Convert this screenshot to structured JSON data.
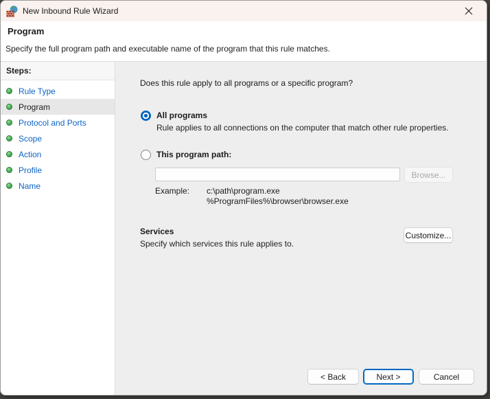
{
  "window": {
    "title": "New Inbound Rule Wizard"
  },
  "icons": {
    "titlebar": "firewall-icon",
    "close": "close-icon",
    "step_bullet": "green-dot-icon"
  },
  "header": {
    "title": "Program",
    "subtitle": "Specify the full program path and executable name of the program that this rule matches."
  },
  "sidebar": {
    "heading": "Steps:",
    "items": [
      {
        "label": "Rule Type",
        "active": false
      },
      {
        "label": "Program",
        "active": true
      },
      {
        "label": "Protocol and Ports",
        "active": false
      },
      {
        "label": "Scope",
        "active": false
      },
      {
        "label": "Action",
        "active": false
      },
      {
        "label": "Profile",
        "active": false
      },
      {
        "label": "Name",
        "active": false
      }
    ]
  },
  "main": {
    "question": "Does this rule apply to all programs or a specific program?",
    "all_programs": {
      "label": "All programs",
      "description": "Rule applies to all connections on the computer that match other rule properties.",
      "selected": true
    },
    "program_path": {
      "label": "This program path:",
      "value": "",
      "browse_label": "Browse...",
      "selected": false
    },
    "example": {
      "label": "Example:",
      "line1": "c:\\path\\program.exe",
      "line2": "%ProgramFiles%\\browser\\browser.exe"
    },
    "services": {
      "title": "Services",
      "description": "Specify which services this rule applies to.",
      "customize_label": "Customize..."
    }
  },
  "footer": {
    "back_label": "< Back",
    "next_label": "Next >",
    "cancel_label": "Cancel"
  },
  "colors": {
    "accent": "#0067c0",
    "link_blue": "#0b63c5",
    "bullet_green": "#4db85a",
    "titlebar_bg": "#f9f2ef",
    "content_bg": "#eeeeee"
  }
}
